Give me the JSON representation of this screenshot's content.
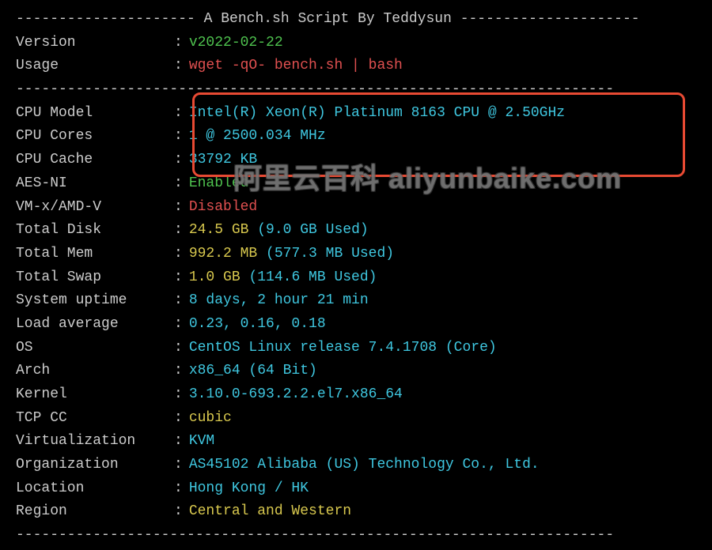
{
  "header": {
    "title": "A Bench.sh Script By Teddysun",
    "dash_left": "--------------------- ",
    "dash_right": " ---------------------"
  },
  "divider": "----------------------------------------------------------------------",
  "version": {
    "label": "Version",
    "value": "v2022-02-22"
  },
  "usage": {
    "label": "Usage",
    "value": "wget -qO- bench.sh | bash"
  },
  "cpu_model": {
    "label": "CPU Model",
    "value": "Intel(R) Xeon(R) Platinum 8163 CPU @ 2.50GHz"
  },
  "cpu_cores": {
    "label": "CPU Cores",
    "value": "1 @ 2500.034 MHz"
  },
  "cpu_cache": {
    "label": "CPU Cache",
    "value": "33792 KB"
  },
  "aes": {
    "label": "AES-NI",
    "value": "Enabled"
  },
  "vmx": {
    "label": "VM-x/AMD-V",
    "value": "Disabled"
  },
  "disk": {
    "label": "Total Disk",
    "value": "24.5 GB",
    "extra": "(9.0 GB Used)"
  },
  "mem": {
    "label": "Total Mem",
    "value": "992.2 MB",
    "extra": "(577.3 MB Used)"
  },
  "swap": {
    "label": "Total Swap",
    "value": "1.0 GB",
    "extra": "(114.6 MB Used)"
  },
  "uptime": {
    "label": "System uptime",
    "value": "8 days, 2 hour 21 min"
  },
  "load": {
    "label": "Load average",
    "value": "0.23, 0.16, 0.18"
  },
  "os": {
    "label": "OS",
    "value": "CentOS Linux release 7.4.1708 (Core)"
  },
  "arch": {
    "label": "Arch",
    "value": "x86_64 (64 Bit)"
  },
  "kernel": {
    "label": "Kernel",
    "value": "3.10.0-693.2.2.el7.x86_64"
  },
  "tcpcc": {
    "label": "TCP CC",
    "value": "cubic"
  },
  "virt": {
    "label": "Virtualization",
    "value": "KVM"
  },
  "org": {
    "label": "Organization",
    "value": "AS45102 Alibaba (US) Technology Co., Ltd."
  },
  "loc": {
    "label": "Location",
    "value": "Hong Kong / HK"
  },
  "region": {
    "label": "Region",
    "value": "Central and Western"
  },
  "watermark": "阿里云百科 aliyunbaike.com"
}
